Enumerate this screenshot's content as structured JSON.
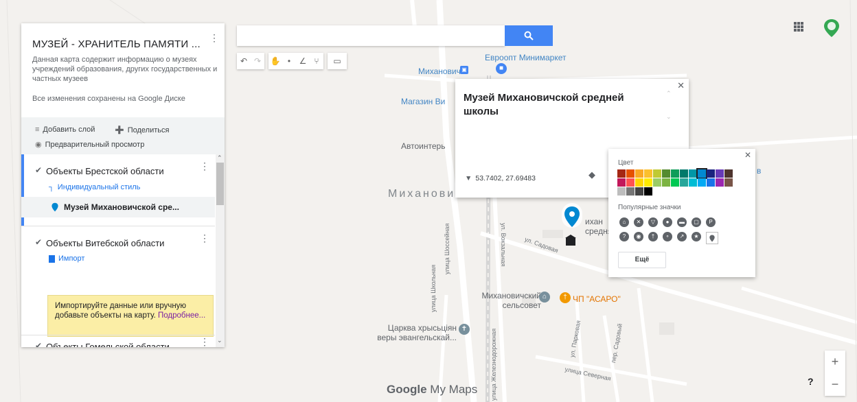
{
  "panel": {
    "title": "МУЗЕЙ - ХРАНИТЕЛЬ ПАМЯТИ ...",
    "description": "Данная карта содержит информацию о музеях учреждений образования, других государственных и частных музеев",
    "saved_status": "Все изменения сохранены на Google Диске",
    "add_layer": "Добавить слой",
    "share": "Поделиться",
    "preview": "Предварительный просмотр",
    "layers": [
      {
        "title": "Объекты Брестской области",
        "style_link": "Индивидуальный стиль",
        "item": "Музей Михановичской сре..."
      },
      {
        "title": "Объекты Витебской области",
        "import_link": "Импорт",
        "hint_text": "Импортируйте данные или вручную добавьте объекты на карту.",
        "hint_link": "Подробнее..."
      },
      {
        "title": "Объекты Гомельской области"
      }
    ]
  },
  "search": {
    "placeholder": "",
    "value": ""
  },
  "toolbar": {
    "icons": [
      "undo-icon",
      "redo-icon",
      "hand-icon",
      "marker-icon",
      "line-icon",
      "route-icon",
      "ruler-icon"
    ]
  },
  "info_window": {
    "title": "Музей Михановичской средней школы",
    "coordinates": "53.7402, 27.69483"
  },
  "color_picker": {
    "color_label": "Цвет",
    "popular_icons_label": "Популярные значки",
    "more_button": "Ещё",
    "colors": [
      "#a52714",
      "#e65100",
      "#f9a825",
      "#fbc02d",
      "#c0ca33",
      "#558b2f",
      "#0f9d58",
      "#00796b",
      "#0097a7",
      "#0288d1",
      "#1a237e",
      "#673ab7",
      "#4e342e",
      "#c2185b",
      "#ff5252",
      "#ffd600",
      "#ffea00",
      "#9ccc65",
      "#7cb342",
      "#00c853",
      "#26a69a",
      "#00bcd4",
      "#03a9f4",
      "#1a73e8",
      "#9c27b0",
      "#795548",
      "#bdbdbd",
      "#757575",
      "#424242",
      "#000000"
    ],
    "selected_color": "#0288d1"
  },
  "map_labels": {
    "evroopt": "Евроопт Минимаркет",
    "mikhanovichi_shop": "Михановичи",
    "magazin": "Магазин Ви",
    "avtointer": "Автоинтерь",
    "town": "Михановичи",
    "museum_partial": "ихан",
    "museum_partial2": "средня",
    "sovet": "Михановичский сельсовет",
    "asaro": "ЧП \"АСАРО\"",
    "church": "Царква хрысьціян веры эвангельскай...",
    "shosseynaya": "улица Шоссейная",
    "vokzalnaya": "ул. Вокзальная",
    "sadovaya": "ул. Садовая",
    "shkolnaya": "улица Школьная",
    "parkovaya": "ул. Парковая",
    "sadovy_per": "пер. Садовый",
    "severnaya": "улица Северная",
    "zheleznodorozhnaya": "улица Железнодорожная",
    "right_edge": "в",
    "logo_google": "Google",
    "logo_mymaps": "My Maps",
    "help": "?"
  }
}
